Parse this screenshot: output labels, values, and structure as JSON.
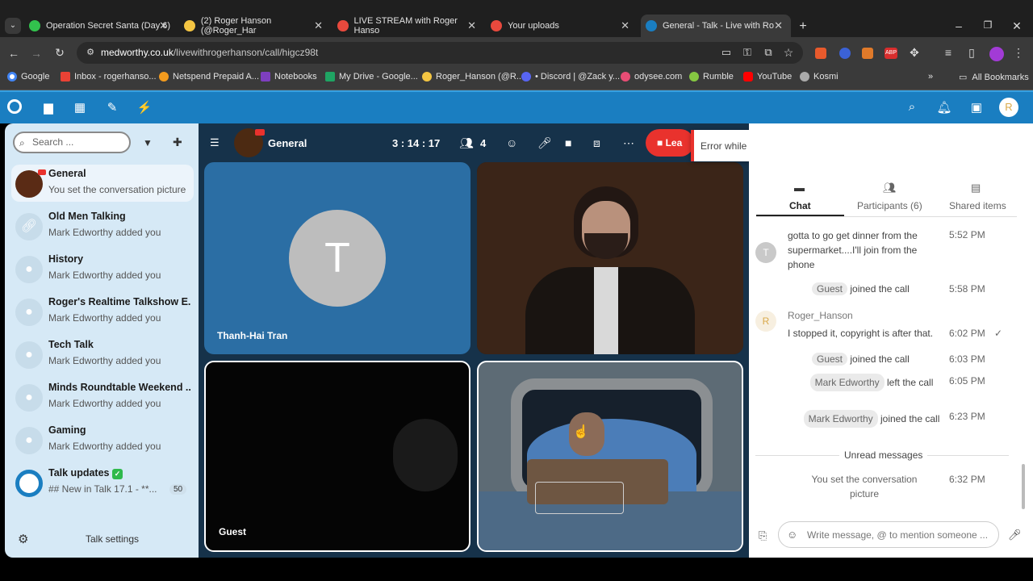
{
  "browser": {
    "tabs": [
      {
        "title": "Operation Secret Santa (Day 6)",
        "color": "#32c24d"
      },
      {
        "title": "(2) Roger Hanson (@Roger_Har",
        "color": "#f4c542"
      },
      {
        "title": "LIVE STREAM with Roger Hanso",
        "color": "#e8493d"
      },
      {
        "title": "Your uploads",
        "color": "#e8493d"
      },
      {
        "title": "General - Talk - Live with Ro",
        "color": "#1a7ec1"
      }
    ],
    "url_host": "medworthy.co.uk",
    "url_path": "/livewithrogerhanson/call/higcz98t",
    "bookmarks": [
      "Google",
      "Inbox - rogerhanso...",
      "Netspend Prepaid A...",
      "Notebooks",
      "My Drive - Google...",
      "Roger_Hanson (@R...",
      "• Discord | @Zack y...",
      "odysee.com",
      "Rumble",
      "YouTube",
      "Kosmi"
    ],
    "all_bookmarks": "All Bookmarks",
    "user_initial": "R"
  },
  "sidebar": {
    "search_placeholder": "Search ...",
    "conversations": [
      {
        "title": "General",
        "subtitle": "You set the conversation picture"
      },
      {
        "title": "Old Men Talking",
        "subtitle": "Mark Edworthy added you"
      },
      {
        "title": "History",
        "subtitle": "Mark Edworthy added you"
      },
      {
        "title": "Roger's Realtime Talkshow E...",
        "subtitle": "Mark Edworthy added you"
      },
      {
        "title": "Tech Talk",
        "subtitle": "Mark Edworthy added you"
      },
      {
        "title": "Minds Roundtable Weekend ...",
        "subtitle": "Mark Edworthy added you"
      },
      {
        "title": "Gaming",
        "subtitle": "Mark Edworthy added you"
      },
      {
        "title": "Talk updates",
        "subtitle": "## New in Talk 17.1 - **...",
        "badge": "50"
      }
    ],
    "settings_label": "Talk settings"
  },
  "call": {
    "room_name": "General",
    "timer": "3 : 14 : 17",
    "participants_count": "4",
    "leave_label": "Lea",
    "tiles": [
      {
        "name": "Thanh-Hai Tran",
        "initial": "T"
      },
      {
        "name": ""
      },
      {
        "name": "Guest"
      },
      {
        "name": ""
      }
    ]
  },
  "toast": {
    "text": "Error while accessing camera: It is likely in use by another program"
  },
  "chat": {
    "tabs": [
      "Chat",
      "Participants (6)",
      "Shared items"
    ],
    "messages": [
      {
        "author_initial": "T",
        "text": "gotta to go get dinner from the supermarket....I'll join from the phone",
        "time": "5:52 PM"
      },
      {
        "system_user": "Guest",
        "system_text": "joined the call",
        "time": "5:58 PM"
      },
      {
        "author": "Roger_Hanson",
        "author_initial": "R",
        "text": "I stopped it, copyright is after that.",
        "time": "6:02 PM"
      },
      {
        "system_user": "Guest",
        "system_text": "joined the call",
        "time": "6:03 PM"
      },
      {
        "system_user": "Mark Edworthy",
        "system_text": "left the call",
        "time": "6:05 PM"
      },
      {
        "system_user": "Mark Edworthy",
        "system_text": "joined the call",
        "time": "6:23 PM"
      },
      {
        "system_text": "You set the conversation picture",
        "time": "6:32 PM"
      }
    ],
    "unread_label": "Unread messages",
    "input_placeholder": "Write message, @ to mention someone ..."
  }
}
